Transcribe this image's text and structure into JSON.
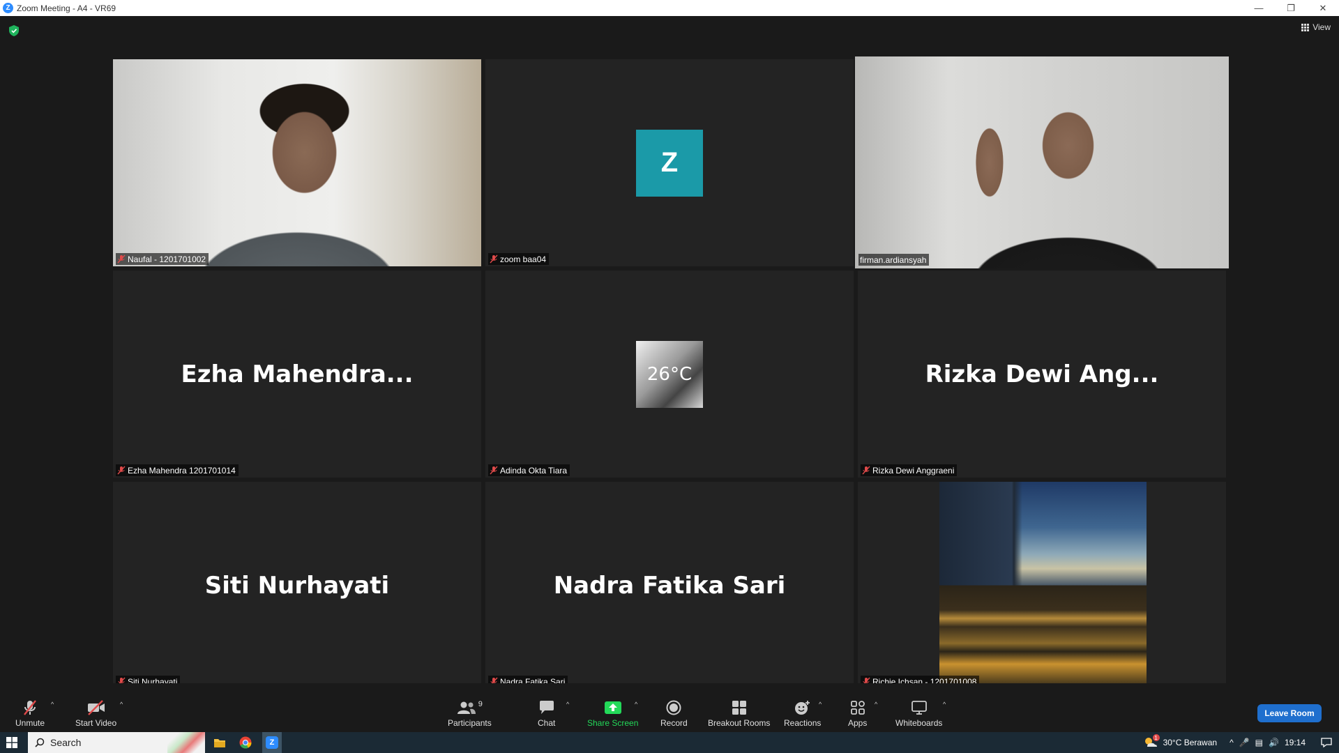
{
  "window": {
    "title": "Zoom Meeting - A4 - VR69",
    "logo_letter": "Z"
  },
  "meeting": {
    "view_label": "View",
    "tiles": [
      {
        "id": "naufal",
        "label": "Naufal - 1201701002",
        "type": "video",
        "active": false,
        "muted": true
      },
      {
        "id": "zoom-baa04",
        "label": "zoom baa04",
        "type": "avatar",
        "avatar_letter": "Z",
        "avatar_color": "#1b9aa8",
        "muted": true
      },
      {
        "id": "firman",
        "label": "firman.ardiansyah",
        "type": "video",
        "active": true,
        "muted": false
      },
      {
        "id": "ezha",
        "label": "Ezha Mahendra 1201701014",
        "display_name": "Ezha  Mahendra...",
        "type": "name",
        "muted": true
      },
      {
        "id": "adinda",
        "label": "Adinda Okta Tiara",
        "type": "avatar-photo",
        "photo_text": "26°C",
        "muted": true
      },
      {
        "id": "rizka",
        "label": "Rizka Dewi Anggraeni",
        "display_name": "Rizka  Dewi  Ang...",
        "type": "name",
        "muted": true
      },
      {
        "id": "siti",
        "label": "Siti Nurhayati",
        "display_name": "Siti Nurhayati",
        "type": "name",
        "muted": true
      },
      {
        "id": "nadra",
        "label": "Nadra Fatika Sari",
        "display_name": "Nadra Fatika Sari",
        "type": "name",
        "muted": true
      },
      {
        "id": "richie",
        "label": "Richie Ichsan - 1201701008",
        "type": "video",
        "muted": true
      }
    ],
    "active_border_color": "#e3f06e"
  },
  "toolbar": {
    "unmute": "Unmute",
    "start_video": "Start Video",
    "participants": "Participants",
    "participants_count": "9",
    "chat": "Chat",
    "share_screen": "Share Screen",
    "record": "Record",
    "breakout_rooms": "Breakout Rooms",
    "reactions": "Reactions",
    "apps": "Apps",
    "whiteboards": "Whiteboards",
    "leave": "Leave Room",
    "share_color": "#23d959",
    "leave_color": "#1f6fce"
  },
  "taskbar": {
    "search_placeholder": "Search",
    "weather": "30°C  Berawan",
    "time": "19:14",
    "weather_badge": "1"
  }
}
